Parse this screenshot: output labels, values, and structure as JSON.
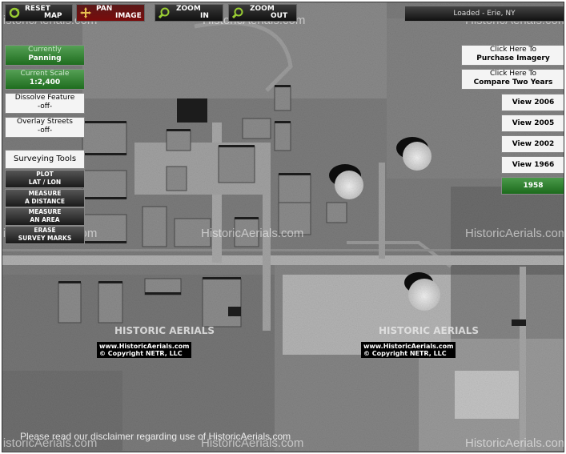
{
  "toolbar": {
    "reset": {
      "line1": "RESET",
      "line2": "MAP"
    },
    "pan": {
      "line1": "PAN",
      "line2": "IMAGE"
    },
    "zoom_in": {
      "line1": "ZOOM",
      "line2": "IN"
    },
    "zoom_out": {
      "line1": "ZOOM",
      "line2": "OUT"
    }
  },
  "status": "Loaded - Erie, NY",
  "left_panel": {
    "mode_label": "Currently",
    "mode_value": "Panning",
    "scale_label": "Current Scale",
    "scale_value": "1:2,400",
    "dissolve_label": "Dissolve Feature",
    "dissolve_value": "-off-",
    "overlay_label": "Overlay Streets",
    "overlay_value": "-off-",
    "surveying_label": "Surveying Tools",
    "tools": [
      {
        "line1": "PLOT",
        "line2": "LAT / LON"
      },
      {
        "line1": "MEASURE",
        "line2": "A DISTANCE"
      },
      {
        "line1": "MEASURE",
        "line2": "AN AREA"
      },
      {
        "line1": "ERASE",
        "line2": "SURVEY MARKS"
      }
    ]
  },
  "right_panel": {
    "purchase": {
      "line1": "Click Here To",
      "line2": "Purchase Imagery"
    },
    "compare": {
      "line1": "Click Here To",
      "line2": "Compare Two Years"
    },
    "years": [
      "View 2006",
      "View 2005",
      "View 2002",
      "View 1966",
      "1958"
    ],
    "selected_year": "1958"
  },
  "watermarks": {
    "site": "HistoricAerials.com",
    "logo": "HISTORIC AERIALS",
    "copy_line1": "www.HistoricAerials.com",
    "copy_line2": "© Copyright NETR, LLC"
  },
  "disclaimer": "Please read our disclaimer regarding use of HistoricAerials.com",
  "colors": {
    "panel_green": "#1f6d1f",
    "toolbar_dark": "#111111",
    "pan_active": "#7a0b0b"
  }
}
